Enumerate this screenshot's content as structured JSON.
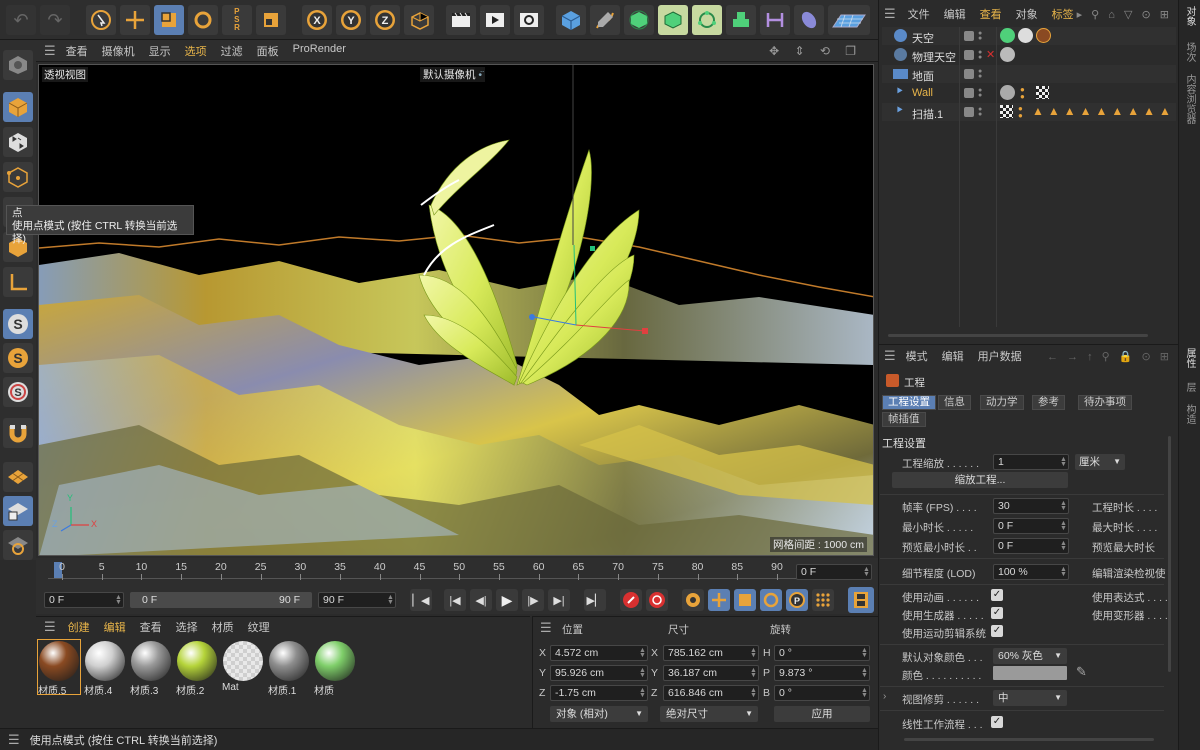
{
  "top_right_menu": {
    "file": "文件",
    "edit": "编辑",
    "view": "查看",
    "object": "对象",
    "tags": "标签"
  },
  "viewport_menu": {
    "view": "查看",
    "camera": "摄像机",
    "display": "显示",
    "options": "选项",
    "filter": "过滤",
    "panel": "面板",
    "prorender": "ProRender"
  },
  "viewport": {
    "name": "透视视图",
    "camera": "默认摄像机",
    "grid_spacing": "网格间距 : 1000 cm",
    "axis_y": "Y",
    "axis_z": "Z",
    "axis_x": "X"
  },
  "tooltip": {
    "title": "点",
    "desc": "使用点模式 (按住 CTRL 转换当前选择)"
  },
  "objects": [
    {
      "name": "天空"
    },
    {
      "name": "物理天空"
    },
    {
      "name": "地面"
    },
    {
      "name": "Wall"
    },
    {
      "name": "扫描.1"
    }
  ],
  "right_tabs": {
    "object": "对象",
    "scene": "场次",
    "content": "内容浏览器",
    "attributes": "属性",
    "layers": "层",
    "structure": "构造"
  },
  "attr_menu": {
    "mode": "模式",
    "edit": "编辑",
    "user_data": "用户数据"
  },
  "attr": {
    "title": "工程",
    "tabs": [
      "工程设置",
      "信息",
      "动力学",
      "参考",
      "待办事项"
    ],
    "tab2": "帧插值",
    "section": "工程设置",
    "scale_label": "工程缩放 . . . . . .",
    "scale_value": "1",
    "scale_unit": "厘米",
    "scale_button": "缩放工程...",
    "fps_label": "帧率 (FPS)  . . . .",
    "fps_value": "30",
    "proj_len_label": "工程时长 . . . .",
    "min_len_label": "最小时长 . . . . .",
    "min_len_value": "0 F",
    "max_len_label": "最大时长 . . . .",
    "preview_min_label": "预览最小时长 . .",
    "preview_min_value": "0 F",
    "preview_max_label": "预览最大时长",
    "lod_label": "细节程度 (LOD)",
    "lod_value": "100 %",
    "render_lod_label": "编辑渲染检视使",
    "use_anim_label": "使用动画 . . . . . .",
    "use_expr_label": "使用表达式 . . . .",
    "use_gen_label": "使用生成器 . . . . .",
    "use_deform_label": "使用变形器 . . . .",
    "use_motion_label": "使用运动剪辑系统",
    "default_color_label": "默认对象颜色 . . .",
    "default_color_value": "60% 灰色",
    "color_label": "颜色 . . . . . . . . . .",
    "view_clip_label": "视图修剪 . . . . . .",
    "view_clip_value": "中",
    "linear_label": "线性工作流程 . . ."
  },
  "timeline": {
    "ticks": [
      "0",
      "5",
      "10",
      "15",
      "20",
      "25",
      "30",
      "35",
      "40",
      "45",
      "50",
      "55",
      "60",
      "65",
      "70",
      "75",
      "80",
      "85",
      "90"
    ],
    "current_frame": "0 F",
    "start": "0 F",
    "range_start": "0 F",
    "range_end": "90 F",
    "end": "90 F"
  },
  "material_menu": {
    "create": "创建",
    "edit": "编辑",
    "view": "查看",
    "select": "选择",
    "material": "材质",
    "texture": "纹理"
  },
  "materials": [
    {
      "name": "材质.5",
      "color": "#8a4a22"
    },
    {
      "name": "材质.4",
      "color": "#d0d0d0"
    },
    {
      "name": "材质.3",
      "color": "#9a9a9a"
    },
    {
      "name": "材质.2",
      "color": "#b5d43a"
    },
    {
      "name": "Mat",
      "color": "#bdbdbd"
    },
    {
      "name": "材质.1",
      "color": "#8e8e8e"
    },
    {
      "name": "材质",
      "color": "#7fcf6a"
    }
  ],
  "coords": {
    "pos_header": "位置",
    "size_header": "尺寸",
    "rot_header": "旋转",
    "x_label": "X",
    "y_label": "Y",
    "z_label": "Z",
    "h_label": "H",
    "p_label": "P",
    "b_label": "B",
    "px": "4.572 cm",
    "py": "95.926 cm",
    "pz": "-1.75 cm",
    "sx": "785.162 cm",
    "sy": "36.187 cm",
    "sz": "616.846 cm",
    "rh": "0 °",
    "rp": "9.873 °",
    "rb": "0 °",
    "mode_select": "对象 (相对)",
    "size_select": "绝对尺寸",
    "apply": "应用"
  },
  "status_bar": "使用点模式 (按住 CTRL 转换当前选择)",
  "colors": {
    "accent_blue": "#5b7fb3",
    "accent_orange": "#e8a33a",
    "panel": "#2b2b2b",
    "viewport_bg": "#000000"
  }
}
